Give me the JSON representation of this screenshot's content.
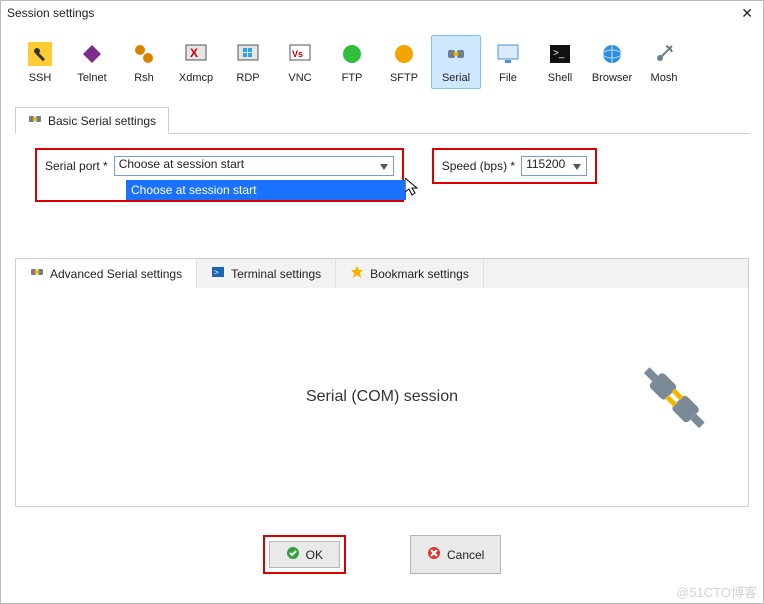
{
  "window": {
    "title": "Session settings"
  },
  "types": [
    {
      "key": "ssh",
      "label": "SSH"
    },
    {
      "key": "telnet",
      "label": "Telnet"
    },
    {
      "key": "rsh",
      "label": "Rsh"
    },
    {
      "key": "xdmcp",
      "label": "Xdmcp"
    },
    {
      "key": "rdp",
      "label": "RDP"
    },
    {
      "key": "vnc",
      "label": "VNC"
    },
    {
      "key": "ftp",
      "label": "FTP"
    },
    {
      "key": "sftp",
      "label": "SFTP"
    },
    {
      "key": "serial",
      "label": "Serial"
    },
    {
      "key": "file",
      "label": "File"
    },
    {
      "key": "shell",
      "label": "Shell"
    },
    {
      "key": "browser",
      "label": "Browser"
    },
    {
      "key": "mosh",
      "label": "Mosh"
    }
  ],
  "basic": {
    "tab_label": "Basic Serial settings",
    "port_label": "Serial port *",
    "port_value": "Choose at session start",
    "port_dropdown_item": "Choose at session start",
    "speed_label": "Speed (bps) *",
    "speed_value": "115200"
  },
  "subtabs": {
    "advanced": "Advanced Serial settings",
    "terminal": "Terminal settings",
    "bookmark": "Bookmark settings"
  },
  "content": {
    "title": "Serial (COM) session"
  },
  "buttons": {
    "ok": "OK",
    "cancel": "Cancel"
  },
  "watermark": "@51CTO博客"
}
